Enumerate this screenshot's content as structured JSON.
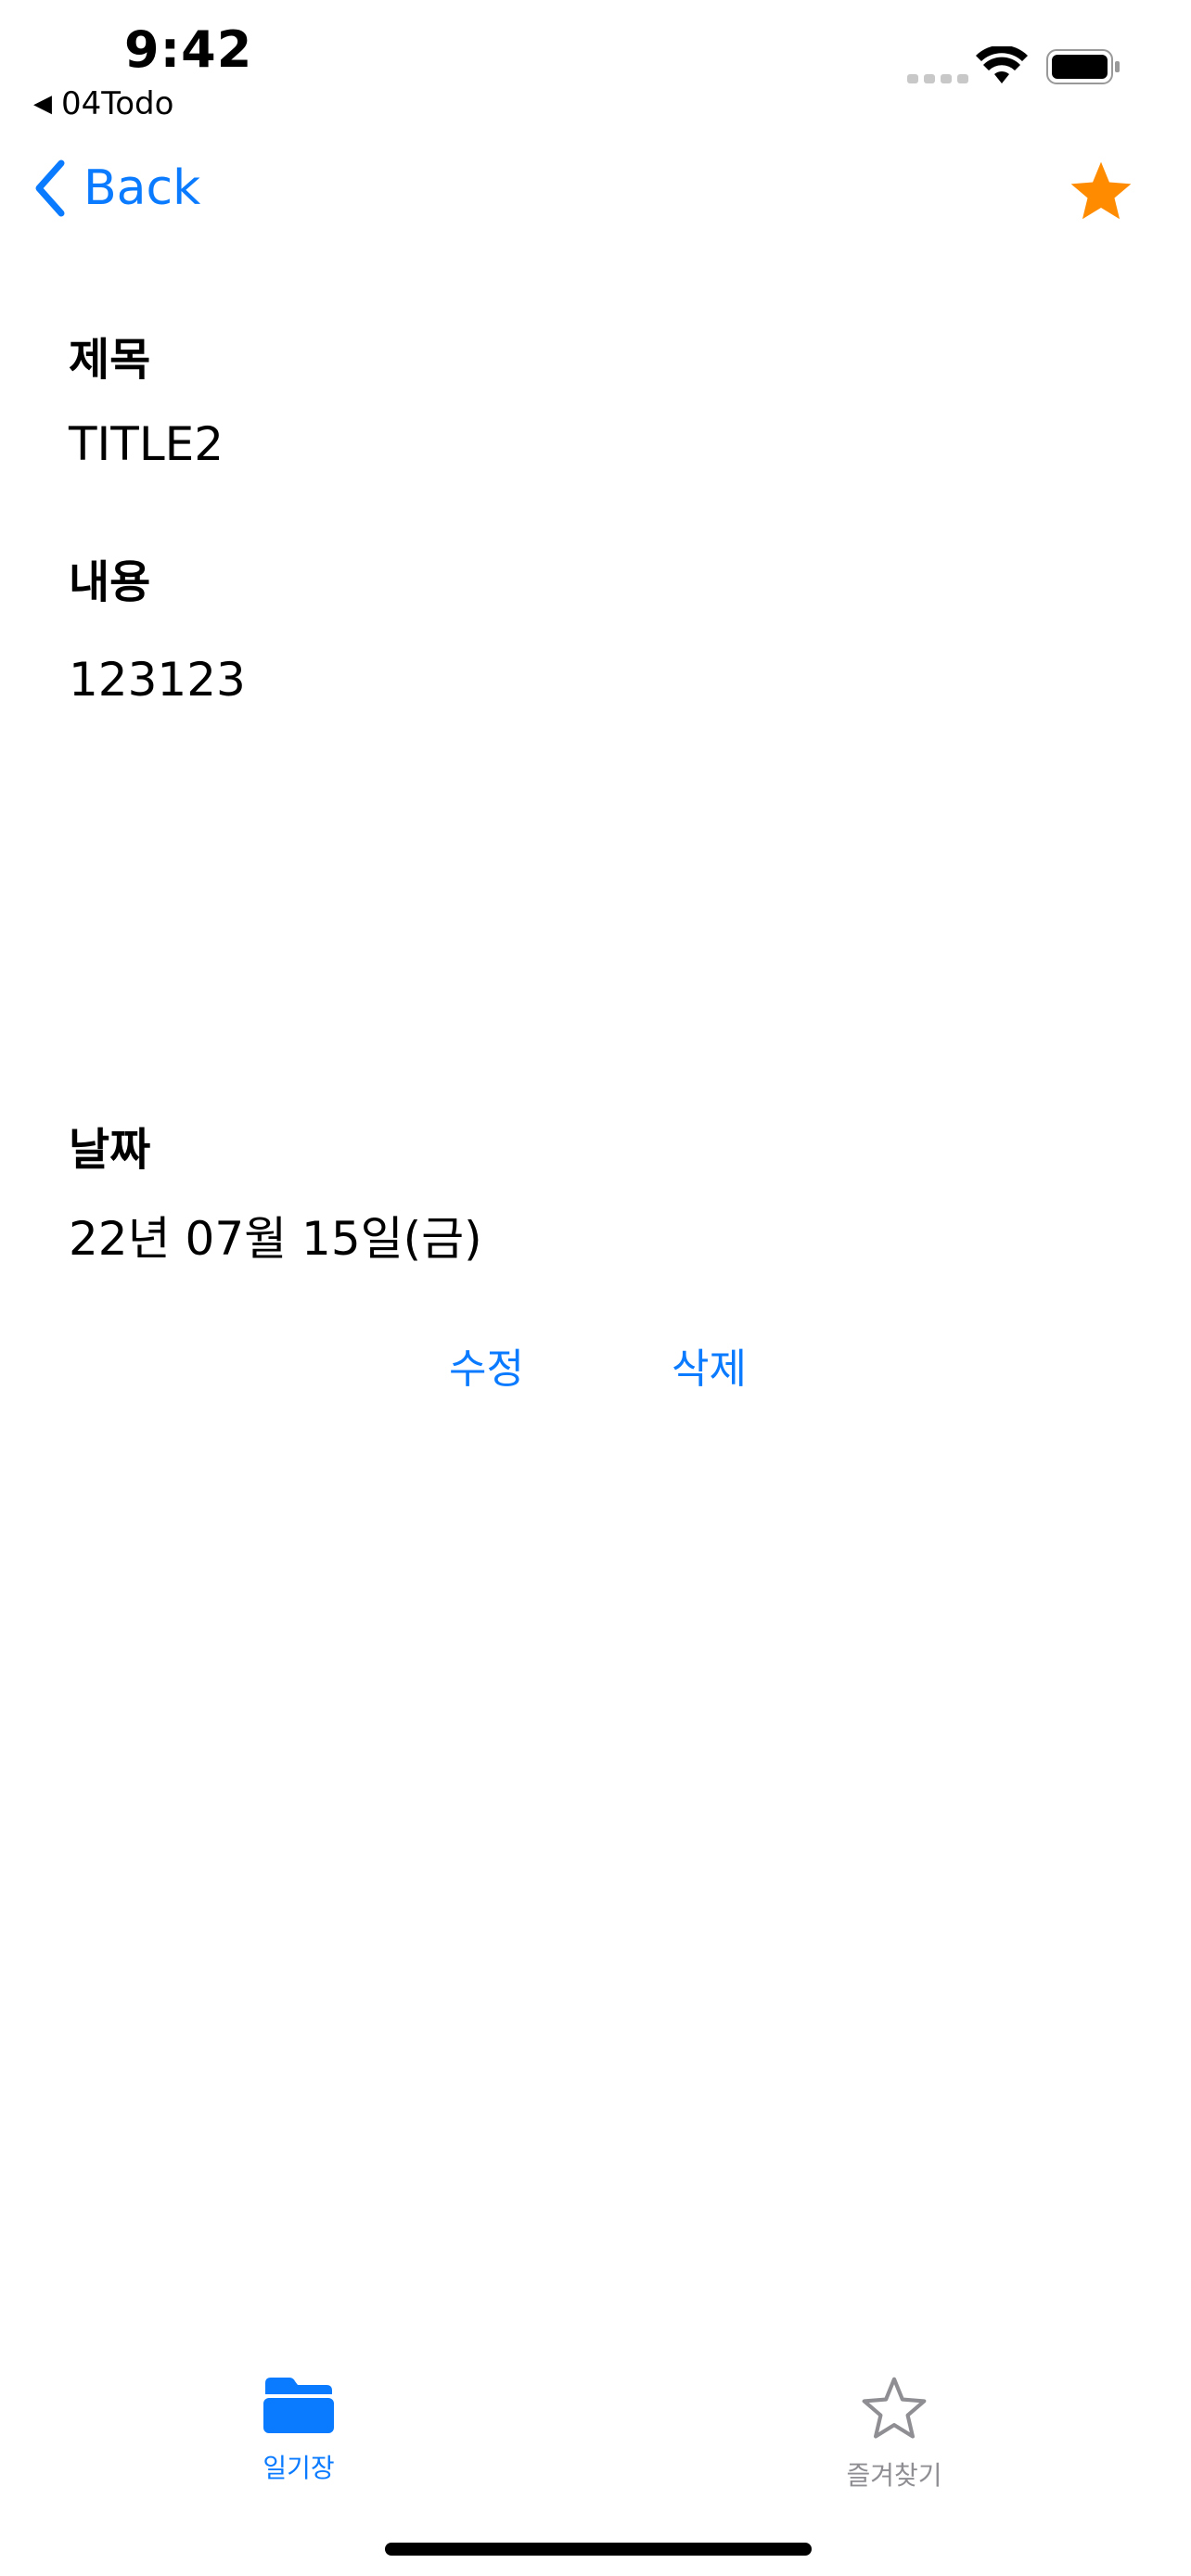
{
  "status_bar": {
    "time": "9:42",
    "back_app_label": "04Todo",
    "icons": [
      "cellular-signal-icon",
      "wifi-icon",
      "battery-icon"
    ]
  },
  "nav": {
    "back_label": "Back",
    "favorite_icon": "star-filled-icon",
    "favorite_color": "#ff8c00"
  },
  "detail": {
    "title_label": "제목",
    "title_value": "TITLE2",
    "content_label": "내용",
    "content_value": "123123",
    "date_label": "날짜",
    "date_value": "22년 07월 15일(금)"
  },
  "actions": {
    "edit_label": "수정",
    "delete_label": "삭제"
  },
  "tab_bar": {
    "tabs": [
      {
        "label": "일기장",
        "icon": "folder-icon",
        "active": true
      },
      {
        "label": "즐겨찾기",
        "icon": "star-outline-icon",
        "active": false
      }
    ]
  },
  "colors": {
    "accent": "#0a7aff",
    "inactive": "#8e8e93",
    "favorite": "#ff8c00"
  }
}
